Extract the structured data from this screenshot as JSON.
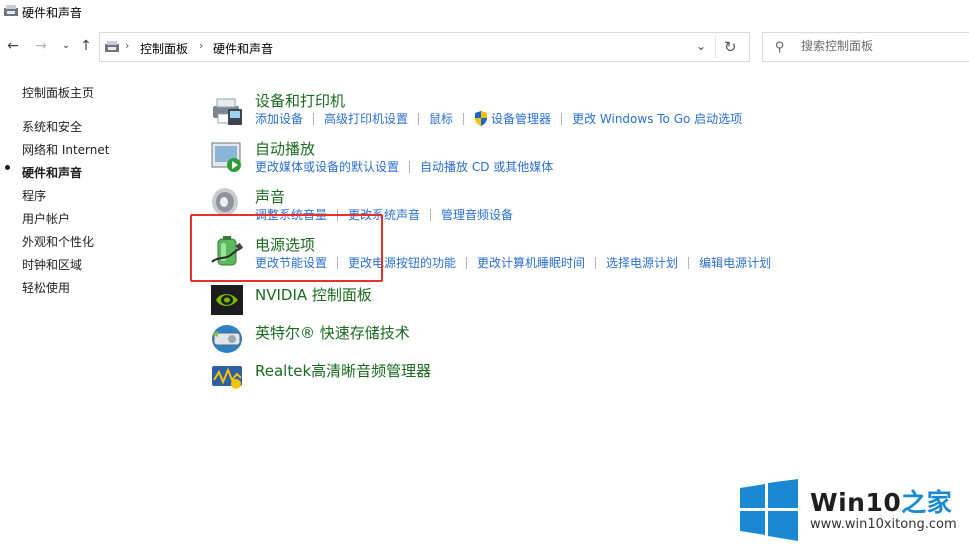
{
  "window": {
    "title": "硬件和声音"
  },
  "addressbar": {
    "crumbs": [
      "控制面板",
      "硬件和声音"
    ],
    "search_placeholder": "搜索控制面板"
  },
  "leftnav": {
    "home": "控制面板主页",
    "items": [
      {
        "label": "系统和安全"
      },
      {
        "label": "网络和 Internet"
      },
      {
        "label": "硬件和声音",
        "current": true
      },
      {
        "label": "程序"
      },
      {
        "label": "用户帐户"
      },
      {
        "label": "外观和个性化"
      },
      {
        "label": "时钟和区域"
      },
      {
        "label": "轻松使用"
      }
    ]
  },
  "categories": [
    {
      "title": "设备和打印机",
      "icon": "printer-icon",
      "links": [
        "添加设备",
        "高级打印机设置",
        "鼠标",
        "设备管理器",
        "更改 Windows To Go 启动选项"
      ]
    },
    {
      "title": "自动播放",
      "icon": "autoplay-icon",
      "links": [
        "更改媒体或设备的默认设置",
        "自动播放 CD 或其他媒体"
      ]
    },
    {
      "title": "声音",
      "icon": "speaker-icon",
      "links": [
        "调整系统音量",
        "更改系统声音",
        "管理音频设备"
      ]
    },
    {
      "title": "电源选项",
      "icon": "battery-icon",
      "links": [
        "更改节能设置",
        "更改电源按钮的功能",
        "更改计算机睡眠时间",
        "选择电源计划",
        "编辑电源计划"
      ]
    },
    {
      "title": "NVIDIA 控制面板",
      "icon": "nvidia-icon",
      "links": []
    },
    {
      "title": "英特尔® 快速存储技术",
      "icon": "intel-storage-icon",
      "links": []
    },
    {
      "title": "Realtek高清晰音频管理器",
      "icon": "realtek-audio-icon",
      "links": []
    }
  ],
  "watermark": {
    "brand_a": "Win10",
    "brand_b": "之家",
    "url": "www.win10xitong.com"
  },
  "colors": {
    "category_title": "#1a6a1f",
    "link": "#2b6fcf",
    "highlight_box": "#e5302c",
    "win_logo": "#1b88d4"
  }
}
